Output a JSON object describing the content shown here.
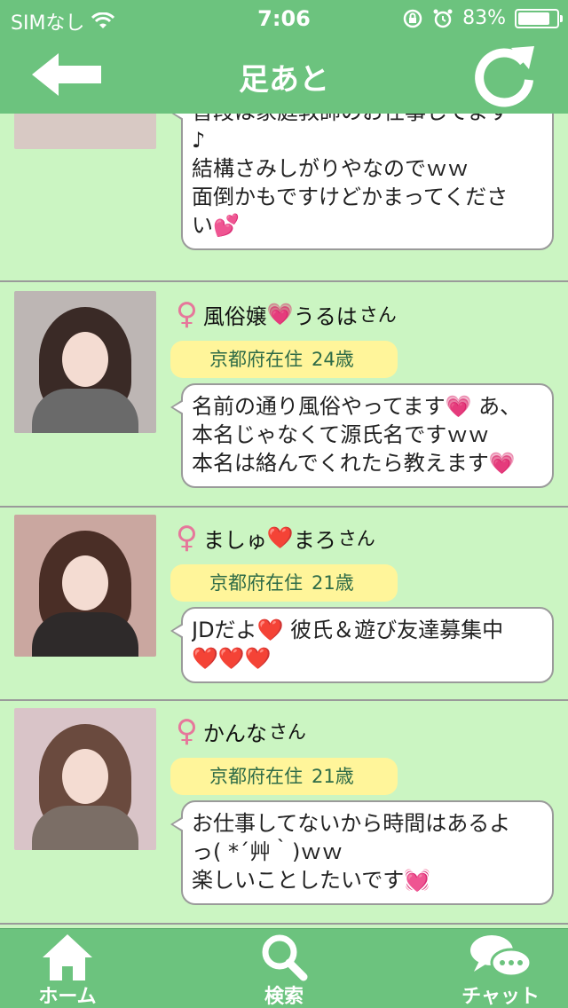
{
  "status_bar": {
    "carrier": "SIMなし",
    "time": "7:06",
    "battery_percent": "83%",
    "battery_level": 0.83,
    "icons": [
      "wifi-icon",
      "rotation-lock-icon",
      "alarm-icon",
      "battery-icon"
    ]
  },
  "nav": {
    "title": "足あと",
    "back_icon": "arrow-left-icon",
    "refresh_icon": "refresh-icon"
  },
  "colors": {
    "accent": "#6cc37e",
    "background": "#cbf5c2",
    "badge": "#fff59a",
    "female_symbol": "#e6779b"
  },
  "partial_item": {
    "message_lines": [
      "普段は家庭教師のお仕事してます",
      "♪",
      "結構さみしがりやなのでｗｗ",
      "面倒かもですけどかまってくださ",
      "い💕"
    ]
  },
  "items": [
    {
      "gender_symbol": "♀",
      "name_parts": [
        "風俗嬢",
        "💗",
        " うるは"
      ],
      "honorific": "さん",
      "location": "京都府在住",
      "age": "24歳",
      "message_lines": [
        "名前の通り風俗やってます💗 あ、",
        "本名じゃなくて源氏名ですｗｗ",
        "本名は絡んでくれたら教えます💗"
      ]
    },
    {
      "gender_symbol": "♀",
      "name_parts": [
        "ましゅ",
        "❤️",
        " まろ"
      ],
      "honorific": "さん",
      "location": "京都府在住",
      "age": "21歳",
      "message_lines": [
        "JDだよ❤️ 彼氏＆遊び友達募集中",
        "❤️❤️❤️"
      ]
    },
    {
      "gender_symbol": "♀",
      "name_parts": [
        "かんな",
        "",
        ""
      ],
      "honorific": "さん",
      "location": "京都府在住",
      "age": "21歳",
      "message_lines": [
        "お仕事してないから時間はあるよ",
        "っ( *´艸｀)ｗｗ",
        "楽しいことしたいです💓"
      ]
    }
  ],
  "tabs": [
    {
      "label": "ホーム",
      "icon": "home-icon"
    },
    {
      "label": "検索",
      "icon": "search-icon"
    },
    {
      "label": "チャット",
      "icon": "chat-icon"
    }
  ]
}
